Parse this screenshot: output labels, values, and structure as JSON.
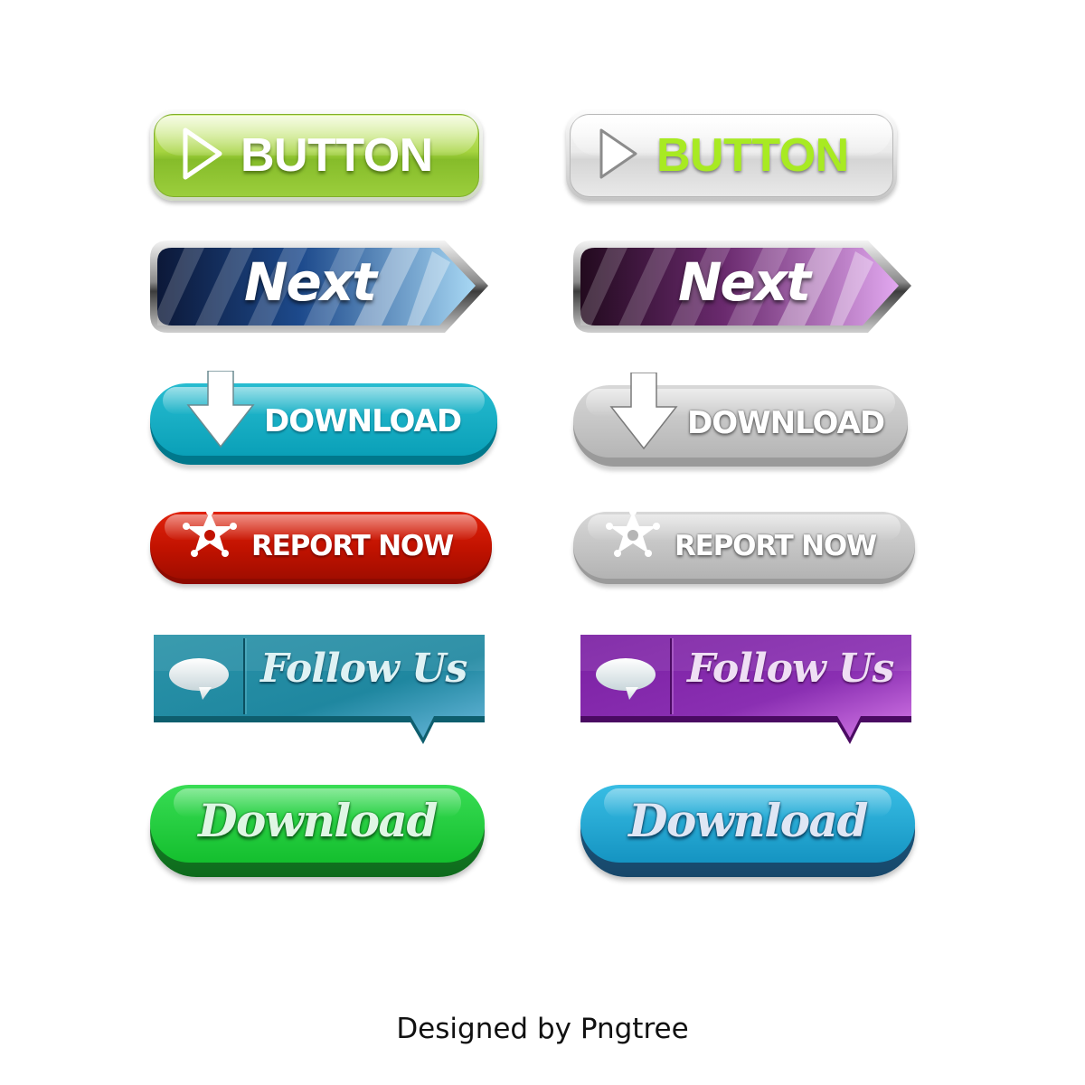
{
  "colors": {
    "green_accent": "#a6d440",
    "lime_text": "#a8ea22",
    "teal": "#0aa0b8",
    "red": "#c11200",
    "gray": "#b5b5b5",
    "purple": "#8a2fb2",
    "blue": "#1594c2",
    "bright_green": "#14bf2e"
  },
  "buttons": {
    "play_green": {
      "label": "BUTTON",
      "icon": "play-icon"
    },
    "play_white": {
      "label": "BUTTON",
      "icon": "play-icon"
    },
    "next_blue": {
      "label": "Next"
    },
    "next_purple": {
      "label": "Next"
    },
    "download_teal": {
      "label": "DOWNLOAD",
      "icon": "down-arrow-icon"
    },
    "download_gray": {
      "label": "DOWNLOAD",
      "icon": "down-arrow-icon"
    },
    "report_red": {
      "label": "REPORT NOW",
      "icon": "star-icon"
    },
    "report_gray": {
      "label": "REPORT NOW",
      "icon": "star-icon"
    },
    "follow_teal": {
      "label": "Follow Us",
      "icon": "speech-bubble-icon"
    },
    "follow_purple": {
      "label": "Follow Us",
      "icon": "speech-bubble-icon"
    },
    "script_download_green": {
      "label": "Download"
    },
    "script_download_blue": {
      "label": "Download"
    }
  },
  "credit": "Designed by Pngtree"
}
